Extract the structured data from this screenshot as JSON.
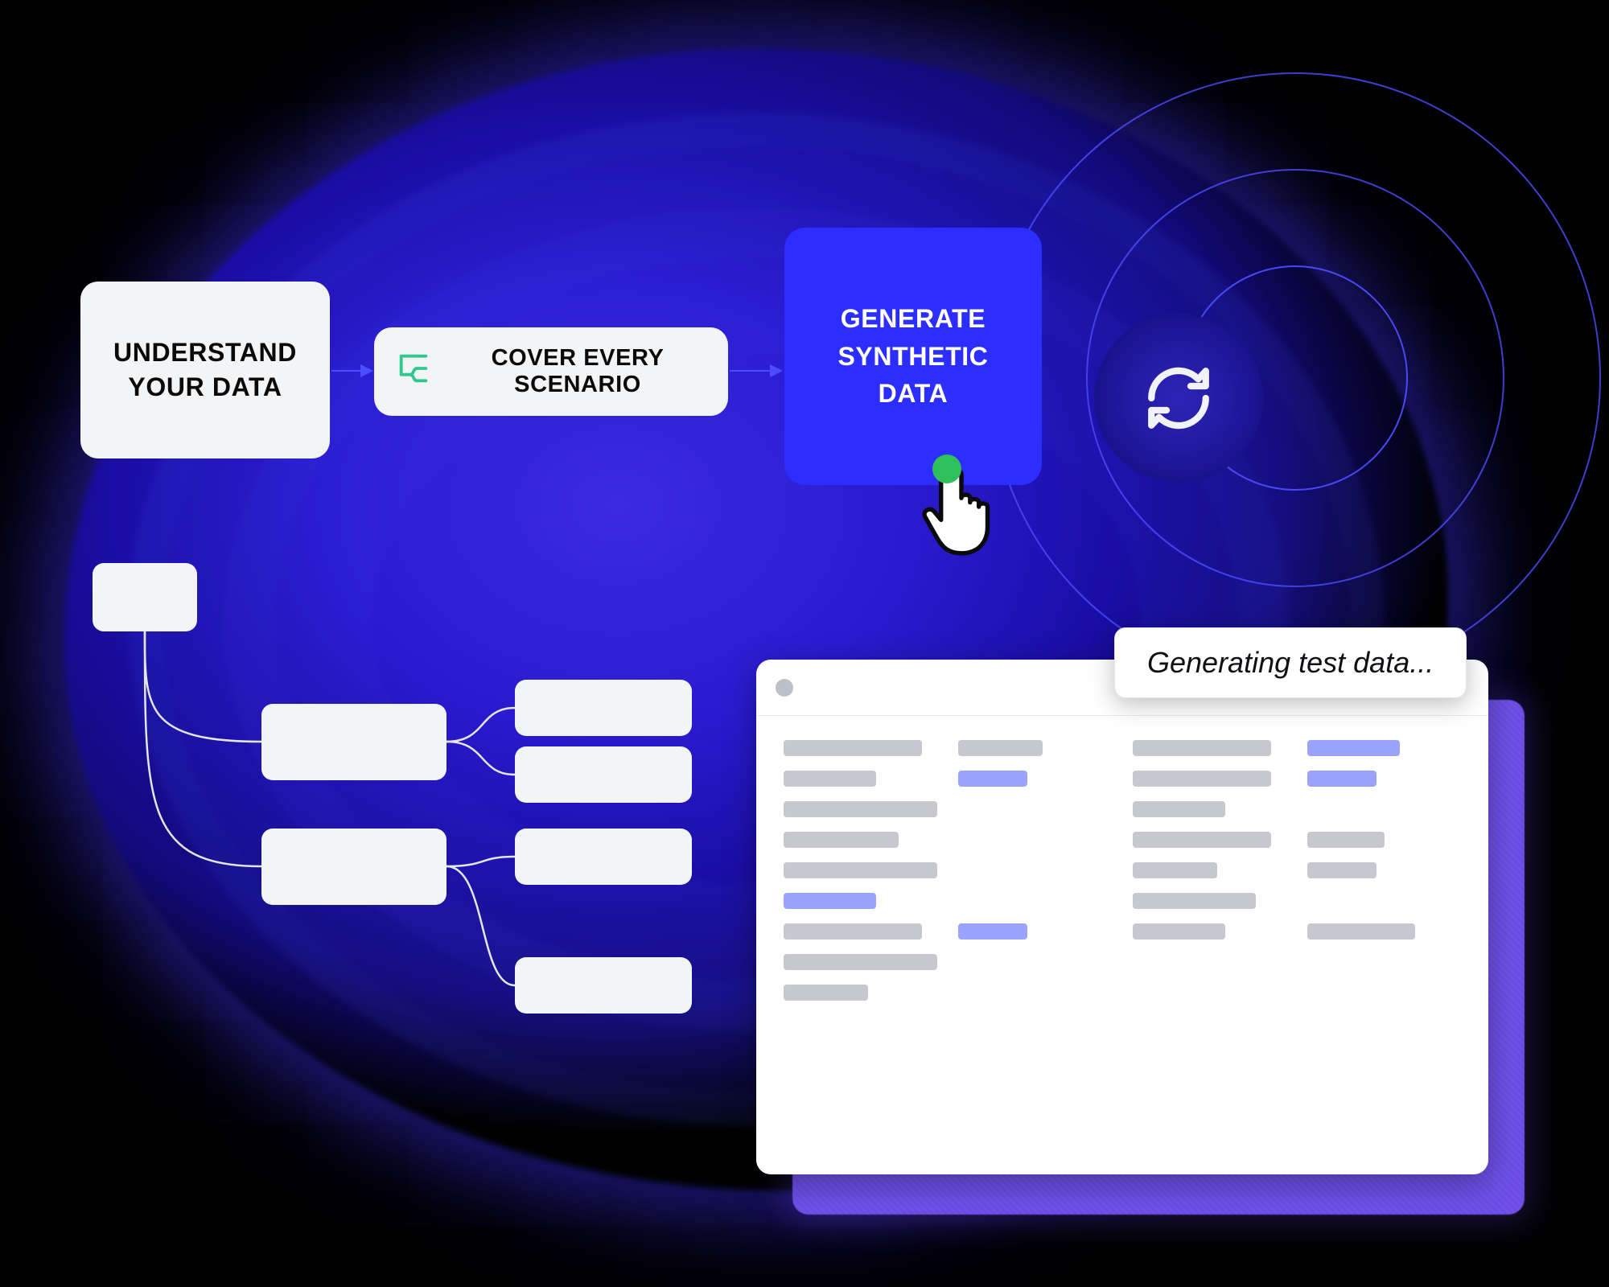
{
  "colors": {
    "background": "#000000",
    "blob_core": "#2a1bd0",
    "accent_blue": "#2c2dff",
    "ring_blue": "#4c4dff",
    "card_bg": "#f3f4f6",
    "bar_grey": "#c7c7cf",
    "bar_accent": "#9aa4ff",
    "touch_green": "#2fc05c",
    "purple_shadow": "#6b4de6"
  },
  "steps": {
    "step1": {
      "label": "UNDERSTAND YOUR DATA"
    },
    "step2": {
      "label": "COVER EVERY SCENARIO",
      "icon": "branch-icon"
    },
    "step3": {
      "label": "GENERATE SYNTHETIC DATA"
    }
  },
  "refresh": {
    "icon": "sync-icon"
  },
  "status": {
    "text": "Generating test data..."
  },
  "window": {
    "columns": 4,
    "rows": [
      [
        {
          "w": "w90"
        },
        {
          "w": "w55"
        },
        {
          "w": "w90"
        },
        {
          "w": "w60",
          "accent": true
        }
      ],
      [
        {
          "w": "w60"
        },
        {
          "w": "w45",
          "accent": true
        },
        {
          "w": "w90"
        },
        {
          "w": "w45",
          "accent": true
        }
      ],
      [
        {
          "w": "w100"
        },
        {
          "w": "w0"
        },
        {
          "w": "w60"
        },
        {
          "w": "w0"
        }
      ],
      [
        {
          "w": "w75"
        },
        {
          "w": "w0"
        },
        {
          "w": "w90"
        },
        {
          "w": "w50"
        }
      ],
      [
        {
          "w": "w100"
        },
        {
          "w": "w0"
        },
        {
          "w": "w55"
        },
        {
          "w": "w45"
        }
      ],
      [
        {
          "w": "w60",
          "accent": true
        },
        {
          "w": "w0"
        },
        {
          "w": "w80"
        },
        {
          "w": "w0"
        }
      ],
      [
        {
          "w": "w90"
        },
        {
          "w": "w45",
          "accent": true
        },
        {
          "w": "w60"
        },
        {
          "w": "w70"
        }
      ],
      [
        {
          "w": "w100"
        },
        {
          "w": "w0"
        },
        {
          "w": "w0"
        },
        {
          "w": "w0"
        }
      ],
      [
        {
          "w": "w55"
        },
        {
          "w": "w0"
        },
        {
          "w": "w0"
        },
        {
          "w": "w0"
        }
      ]
    ]
  }
}
